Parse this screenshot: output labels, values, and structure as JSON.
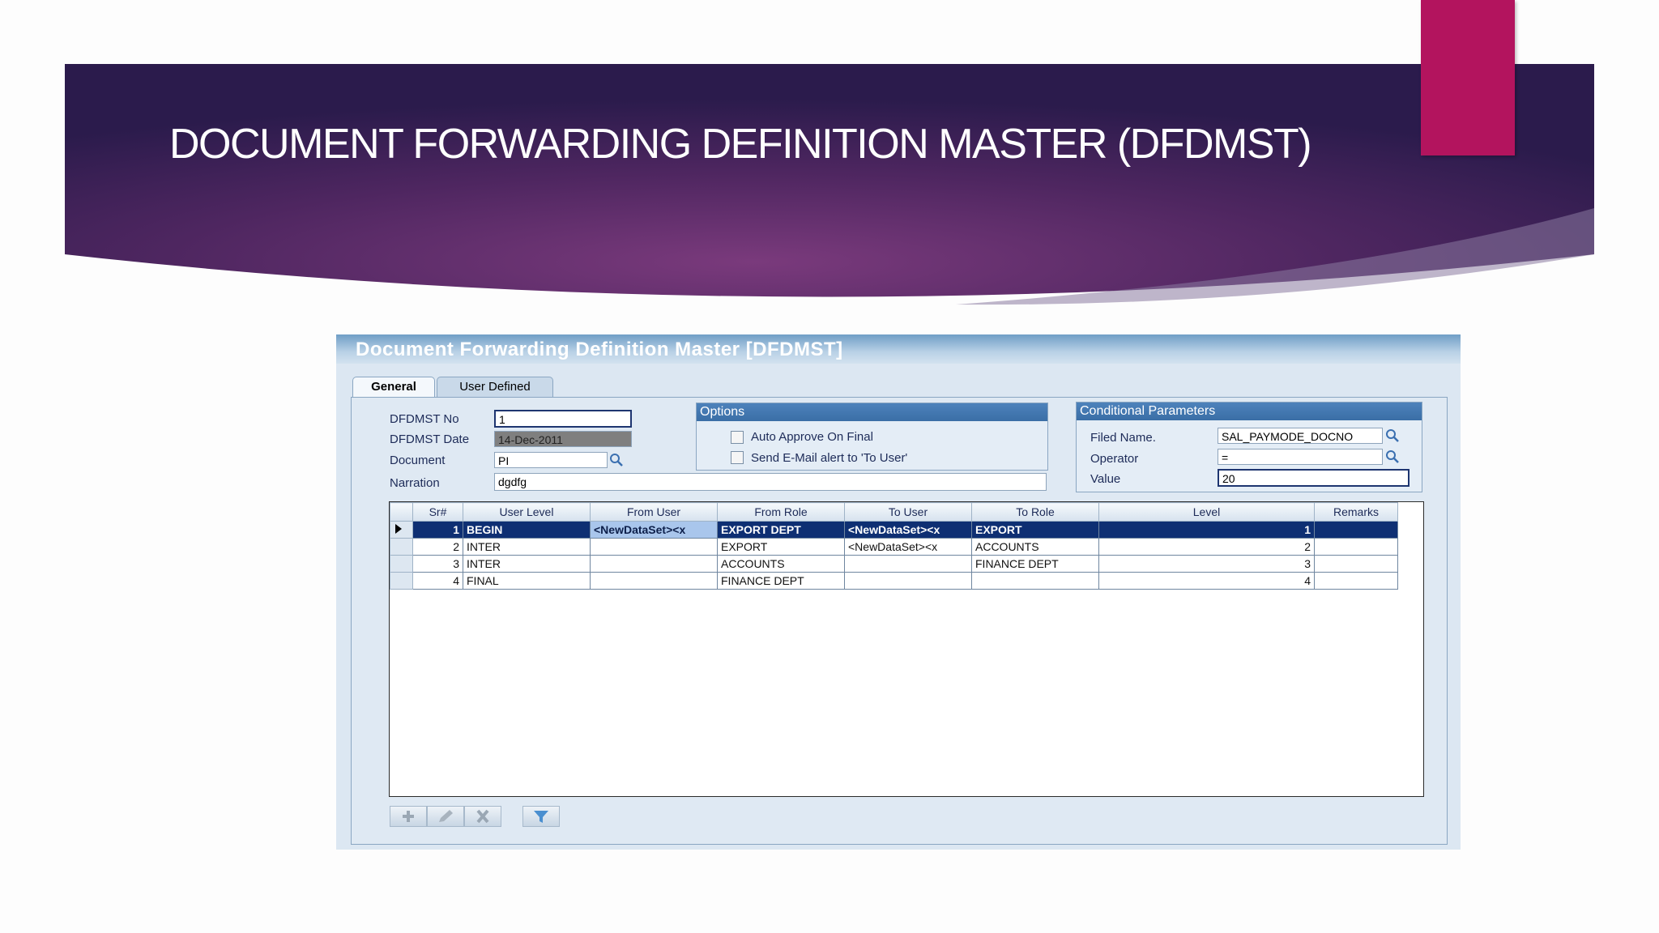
{
  "slide": {
    "title": "DOCUMENT FORWARDING DEFINITION MASTER (DFDMST)"
  },
  "window": {
    "title": "Document Forwarding Definition Master [DFDMST]"
  },
  "tabs": [
    {
      "label": "General",
      "active": true
    },
    {
      "label": "User Defined",
      "active": false
    }
  ],
  "form": {
    "dfdmst_no_label": "DFDMST No",
    "dfdmst_no_value": "1",
    "dfdmst_date_label": "DFDMST Date",
    "dfdmst_date_value": "14-Dec-2011",
    "document_label": "Document",
    "document_value": "PI",
    "narration_label": "Narration",
    "narration_value": "dgdfg"
  },
  "options": {
    "title": "Options",
    "auto_approve_label": "Auto Approve On Final",
    "send_email_label": "Send E-Mail alert to 'To User'"
  },
  "conditional": {
    "title": "Conditional Parameters",
    "filed_name_label": "Filed Name.",
    "filed_name_value": "SAL_PAYMODE_DOCNO",
    "operator_label": "Operator",
    "operator_value": "=",
    "value_label": "Value",
    "value_value": "20"
  },
  "grid": {
    "columns": [
      "Sr#",
      "User Level",
      "From User",
      "From Role",
      "To User",
      "To Role",
      "Level",
      "Remarks"
    ],
    "rows": [
      {
        "sr": "1",
        "user_level": "BEGIN",
        "from_user": "<NewDataSet><x",
        "from_role": "EXPORT DEPT",
        "to_user": "<NewDataSet><x",
        "to_role": "EXPORT",
        "level": "1",
        "remarks": ""
      },
      {
        "sr": "2",
        "user_level": "INTER",
        "from_user": "",
        "from_role": "EXPORT",
        "to_user": "<NewDataSet><x",
        "to_role": "ACCOUNTS",
        "level": "2",
        "remarks": ""
      },
      {
        "sr": "3",
        "user_level": "INTER",
        "from_user": "",
        "from_role": "ACCOUNTS",
        "to_user": "",
        "to_role": "FINANCE DEPT",
        "level": "3",
        "remarks": ""
      },
      {
        "sr": "4",
        "user_level": "FINAL",
        "from_user": "",
        "from_role": "FINANCE DEPT",
        "to_user": "",
        "to_role": "",
        "level": "4",
        "remarks": ""
      }
    ]
  },
  "toolbar": {
    "icons": [
      "add-icon",
      "edit-icon",
      "delete-icon",
      "filter-icon"
    ]
  },
  "colors": {
    "banner_dark": "#2a1a4a",
    "banner_mid": "#6b2f6e",
    "accent_pink": "#b3145e",
    "grid_selection": "#0e2f73",
    "group_header": "#3f72aa"
  }
}
